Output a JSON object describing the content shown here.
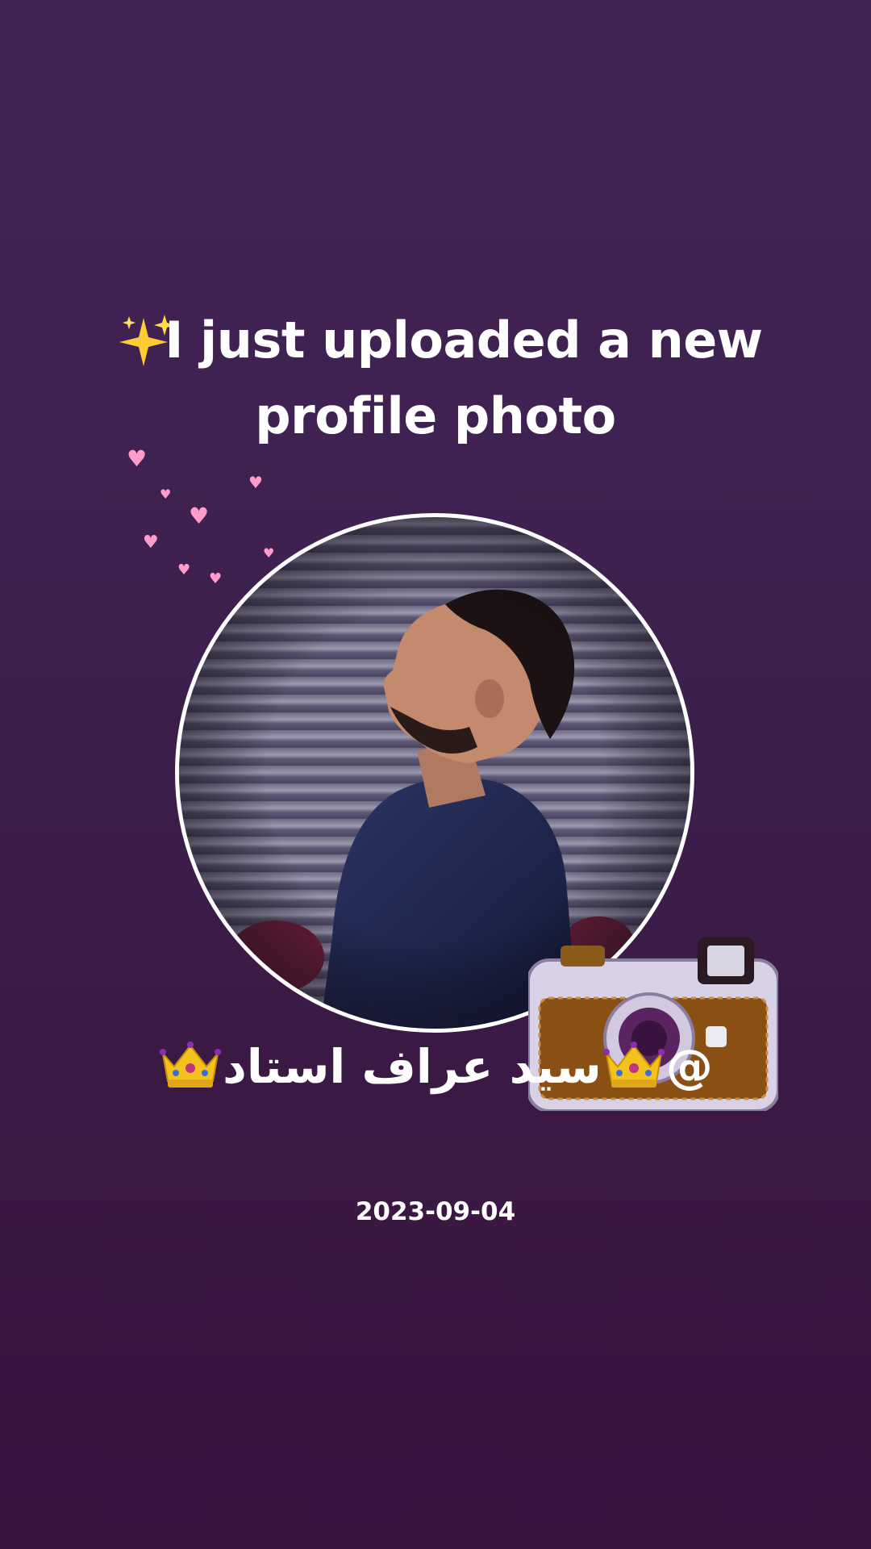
{
  "post": {
    "headline": "I just uploaded a new profile photo",
    "sparkle_icon": "sparkles-icon",
    "username": "@👑سيد عراف استاد👑",
    "username_at": "@",
    "username_name": "سيد عراف استاد",
    "date": "2023-09-04"
  },
  "decorations": {
    "hearts_color": "#ff9ccc",
    "camera_icon": "camera-icon",
    "crown_icon": "crown-icon"
  },
  "colors": {
    "background_top": "#432555",
    "background_bottom": "#38143f",
    "text": "#ffffff",
    "photo_border": "#ffffff"
  }
}
